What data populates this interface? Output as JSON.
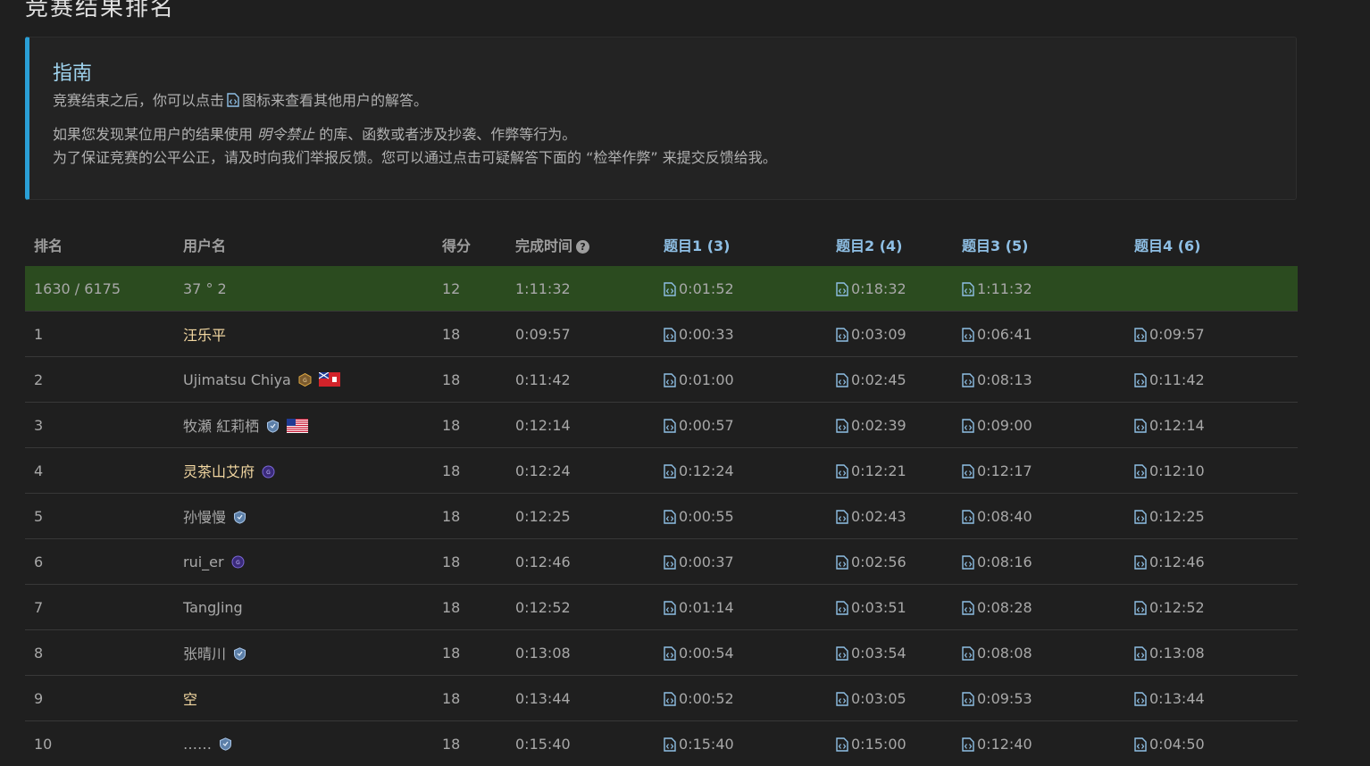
{
  "page_title_fragment": "竞赛结果排名",
  "guide": {
    "title": "指南",
    "line1_before": "竞赛结束之后，你可以点击",
    "line1_after": "图标来查看其他用户的解答。",
    "line2_before": "如果您发现某位用户的结果使用",
    "line2_em": "明令禁止",
    "line2_after": "的库、函数或者涉及抄袭、作弊等行为。",
    "line3": "为了保证竞赛的公平公正，请及时向我们举报反馈。您可以通过点击可疑解答下面的 “检举作弊” 来提交反馈给我。",
    "icon": "code-file-icon"
  },
  "columns": {
    "rank": "排名",
    "username": "用户名",
    "score": "得分",
    "finish_time": "完成时间",
    "help_icon": "question-circle-icon",
    "q1": "题目1 (3)",
    "q2": "题目2 (4)",
    "q3": "题目3 (5)",
    "q4": "题目4 (6)"
  },
  "current_user": {
    "rank": "1630 / 6175",
    "name": "37 ° 2",
    "score": "12",
    "time": "1:11:32",
    "q1": "0:01:52",
    "q2": "0:18:32",
    "q3": "1:11:32",
    "q4": ""
  },
  "rows": [
    {
      "rank": "1",
      "name": "汪乐平",
      "gold": true,
      "badge": "",
      "flag": "",
      "score": "18",
      "time": "0:09:57",
      "q1": "0:00:33",
      "q2": "0:03:09",
      "q3": "0:06:41",
      "q4": "0:09:57"
    },
    {
      "rank": "2",
      "name": "Ujimatsu Chiya",
      "gold": false,
      "badge": "guardian",
      "flag": "bermuda",
      "score": "18",
      "time": "0:11:42",
      "q1": "0:01:00",
      "q2": "0:02:45",
      "q3": "0:08:13",
      "q4": "0:11:42"
    },
    {
      "rank": "3",
      "name": "牧瀬 紅莉栖",
      "gold": false,
      "badge": "knight",
      "flag": "usa",
      "score": "18",
      "time": "0:12:14",
      "q1": "0:00:57",
      "q2": "0:02:39",
      "q3": "0:09:00",
      "q4": "0:12:14"
    },
    {
      "rank": "4",
      "name": "灵茶山艾府",
      "gold": true,
      "badge": "guardian-purple",
      "flag": "",
      "score": "18",
      "time": "0:12:24",
      "q1": "0:12:24",
      "q2": "0:12:21",
      "q3": "0:12:17",
      "q4": "0:12:10"
    },
    {
      "rank": "5",
      "name": "孙慢慢",
      "gold": false,
      "badge": "knight",
      "flag": "",
      "score": "18",
      "time": "0:12:25",
      "q1": "0:00:55",
      "q2": "0:02:43",
      "q3": "0:08:40",
      "q4": "0:12:25"
    },
    {
      "rank": "6",
      "name": "rui_er",
      "gold": false,
      "badge": "guardian-purple",
      "flag": "",
      "score": "18",
      "time": "0:12:46",
      "q1": "0:00:37",
      "q2": "0:02:56",
      "q3": "0:08:16",
      "q4": "0:12:46"
    },
    {
      "rank": "7",
      "name": "TangJing",
      "gold": false,
      "badge": "",
      "flag": "",
      "score": "18",
      "time": "0:12:52",
      "q1": "0:01:14",
      "q2": "0:03:51",
      "q3": "0:08:28",
      "q4": "0:12:52"
    },
    {
      "rank": "8",
      "name": "张晴川",
      "gold": false,
      "badge": "knight",
      "flag": "",
      "score": "18",
      "time": "0:13:08",
      "q1": "0:00:54",
      "q2": "0:03:54",
      "q3": "0:08:08",
      "q4": "0:13:08"
    },
    {
      "rank": "9",
      "name": "空",
      "gold": true,
      "badge": "",
      "flag": "",
      "score": "18",
      "time": "0:13:44",
      "q1": "0:00:52",
      "q2": "0:03:05",
      "q3": "0:09:53",
      "q4": "0:13:44"
    },
    {
      "rank": "10",
      "name": "……",
      "gold": false,
      "badge": "knight",
      "flag": "",
      "score": "18",
      "time": "0:15:40",
      "q1": "0:15:40",
      "q2": "0:15:00",
      "q3": "0:12:40",
      "q4": "0:04:50"
    }
  ],
  "colors": {
    "background": "#1f1f1f",
    "accent": "#2a9fd6",
    "highlight_row": "#2b4b1f",
    "gold_name": "#f2d7a1",
    "question_header": "#8fc0e6"
  }
}
